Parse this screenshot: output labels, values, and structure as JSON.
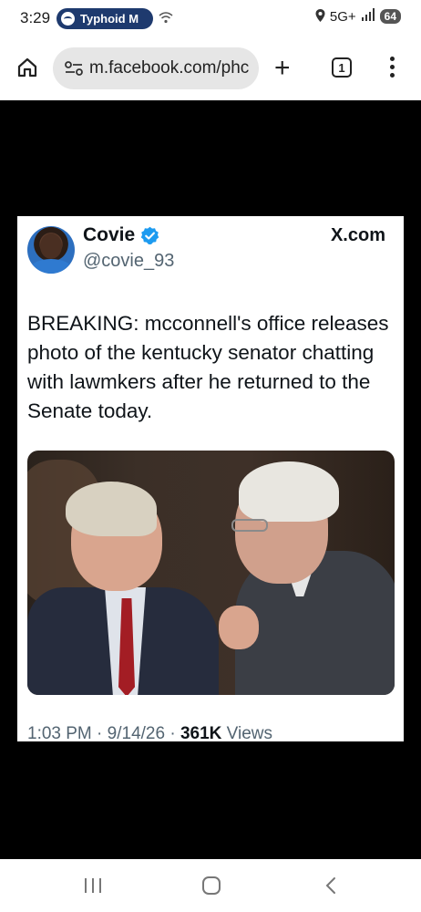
{
  "status_bar": {
    "time": "3:29",
    "media_label": "Typhoid M",
    "network": "5G+",
    "battery": "64"
  },
  "browser": {
    "url": "m.facebook.com/phc",
    "tab_count": "1"
  },
  "tweet": {
    "display_name": "Covie",
    "handle": "@covie_93",
    "source": "X.com",
    "text": "BREAKING: mcconnell's office releases photo of the kentucky senator chatting with lawmkers after he returned to the Senate today.",
    "time": "1:03 PM",
    "date": "9/14/26",
    "views_count": "361K",
    "views_label": "Views"
  },
  "colors": {
    "verified": "#1d9bf0",
    "text_primary": "#0f1419",
    "text_secondary": "#536471"
  }
}
